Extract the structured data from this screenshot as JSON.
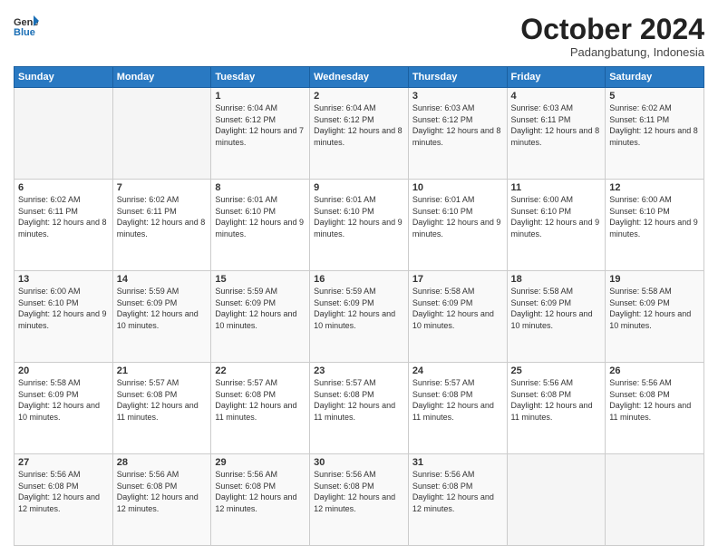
{
  "header": {
    "logo_general": "General",
    "logo_blue": "Blue",
    "month_title": "October 2024",
    "subtitle": "Padangbatung, Indonesia"
  },
  "weekdays": [
    "Sunday",
    "Monday",
    "Tuesday",
    "Wednesday",
    "Thursday",
    "Friday",
    "Saturday"
  ],
  "weeks": [
    [
      {
        "day": "",
        "info": ""
      },
      {
        "day": "",
        "info": ""
      },
      {
        "day": "1",
        "info": "Sunrise: 6:04 AM\nSunset: 6:12 PM\nDaylight: 12 hours and 7 minutes."
      },
      {
        "day": "2",
        "info": "Sunrise: 6:04 AM\nSunset: 6:12 PM\nDaylight: 12 hours and 8 minutes."
      },
      {
        "day": "3",
        "info": "Sunrise: 6:03 AM\nSunset: 6:12 PM\nDaylight: 12 hours and 8 minutes."
      },
      {
        "day": "4",
        "info": "Sunrise: 6:03 AM\nSunset: 6:11 PM\nDaylight: 12 hours and 8 minutes."
      },
      {
        "day": "5",
        "info": "Sunrise: 6:02 AM\nSunset: 6:11 PM\nDaylight: 12 hours and 8 minutes."
      }
    ],
    [
      {
        "day": "6",
        "info": "Sunrise: 6:02 AM\nSunset: 6:11 PM\nDaylight: 12 hours and 8 minutes."
      },
      {
        "day": "7",
        "info": "Sunrise: 6:02 AM\nSunset: 6:11 PM\nDaylight: 12 hours and 8 minutes."
      },
      {
        "day": "8",
        "info": "Sunrise: 6:01 AM\nSunset: 6:10 PM\nDaylight: 12 hours and 9 minutes."
      },
      {
        "day": "9",
        "info": "Sunrise: 6:01 AM\nSunset: 6:10 PM\nDaylight: 12 hours and 9 minutes."
      },
      {
        "day": "10",
        "info": "Sunrise: 6:01 AM\nSunset: 6:10 PM\nDaylight: 12 hours and 9 minutes."
      },
      {
        "day": "11",
        "info": "Sunrise: 6:00 AM\nSunset: 6:10 PM\nDaylight: 12 hours and 9 minutes."
      },
      {
        "day": "12",
        "info": "Sunrise: 6:00 AM\nSunset: 6:10 PM\nDaylight: 12 hours and 9 minutes."
      }
    ],
    [
      {
        "day": "13",
        "info": "Sunrise: 6:00 AM\nSunset: 6:10 PM\nDaylight: 12 hours and 9 minutes."
      },
      {
        "day": "14",
        "info": "Sunrise: 5:59 AM\nSunset: 6:09 PM\nDaylight: 12 hours and 10 minutes."
      },
      {
        "day": "15",
        "info": "Sunrise: 5:59 AM\nSunset: 6:09 PM\nDaylight: 12 hours and 10 minutes."
      },
      {
        "day": "16",
        "info": "Sunrise: 5:59 AM\nSunset: 6:09 PM\nDaylight: 12 hours and 10 minutes."
      },
      {
        "day": "17",
        "info": "Sunrise: 5:58 AM\nSunset: 6:09 PM\nDaylight: 12 hours and 10 minutes."
      },
      {
        "day": "18",
        "info": "Sunrise: 5:58 AM\nSunset: 6:09 PM\nDaylight: 12 hours and 10 minutes."
      },
      {
        "day": "19",
        "info": "Sunrise: 5:58 AM\nSunset: 6:09 PM\nDaylight: 12 hours and 10 minutes."
      }
    ],
    [
      {
        "day": "20",
        "info": "Sunrise: 5:58 AM\nSunset: 6:09 PM\nDaylight: 12 hours and 10 minutes."
      },
      {
        "day": "21",
        "info": "Sunrise: 5:57 AM\nSunset: 6:08 PM\nDaylight: 12 hours and 11 minutes."
      },
      {
        "day": "22",
        "info": "Sunrise: 5:57 AM\nSunset: 6:08 PM\nDaylight: 12 hours and 11 minutes."
      },
      {
        "day": "23",
        "info": "Sunrise: 5:57 AM\nSunset: 6:08 PM\nDaylight: 12 hours and 11 minutes."
      },
      {
        "day": "24",
        "info": "Sunrise: 5:57 AM\nSunset: 6:08 PM\nDaylight: 12 hours and 11 minutes."
      },
      {
        "day": "25",
        "info": "Sunrise: 5:56 AM\nSunset: 6:08 PM\nDaylight: 12 hours and 11 minutes."
      },
      {
        "day": "26",
        "info": "Sunrise: 5:56 AM\nSunset: 6:08 PM\nDaylight: 12 hours and 11 minutes."
      }
    ],
    [
      {
        "day": "27",
        "info": "Sunrise: 5:56 AM\nSunset: 6:08 PM\nDaylight: 12 hours and 12 minutes."
      },
      {
        "day": "28",
        "info": "Sunrise: 5:56 AM\nSunset: 6:08 PM\nDaylight: 12 hours and 12 minutes."
      },
      {
        "day": "29",
        "info": "Sunrise: 5:56 AM\nSunset: 6:08 PM\nDaylight: 12 hours and 12 minutes."
      },
      {
        "day": "30",
        "info": "Sunrise: 5:56 AM\nSunset: 6:08 PM\nDaylight: 12 hours and 12 minutes."
      },
      {
        "day": "31",
        "info": "Sunrise: 5:56 AM\nSunset: 6:08 PM\nDaylight: 12 hours and 12 minutes."
      },
      {
        "day": "",
        "info": ""
      },
      {
        "day": "",
        "info": ""
      }
    ]
  ]
}
